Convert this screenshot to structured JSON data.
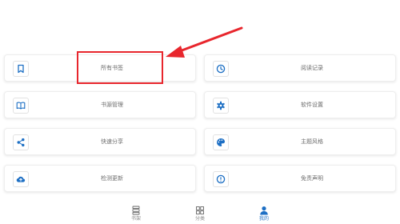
{
  "colors": {
    "accent": "#1d6fc4",
    "highlight": "#e8262d"
  },
  "menu": [
    {
      "label": "所有书签",
      "icon": "bookmark-icon"
    },
    {
      "label": "阅读记录",
      "icon": "clock-icon"
    },
    {
      "label": "书源管理",
      "icon": "book-icon"
    },
    {
      "label": "软件设置",
      "icon": "gear-icon"
    },
    {
      "label": "快速分享",
      "icon": "share-icon"
    },
    {
      "label": "主题风格",
      "icon": "palette-icon"
    },
    {
      "label": "检测更新",
      "icon": "cloud-upload-icon"
    },
    {
      "label": "免责声明",
      "icon": "alert-icon"
    }
  ],
  "bottom_nav": [
    {
      "label": "书架",
      "icon": "bookshelf-icon",
      "active": false
    },
    {
      "label": "分类",
      "icon": "grid-icon",
      "active": false
    },
    {
      "label": "我的",
      "icon": "person-icon",
      "active": true
    }
  ]
}
